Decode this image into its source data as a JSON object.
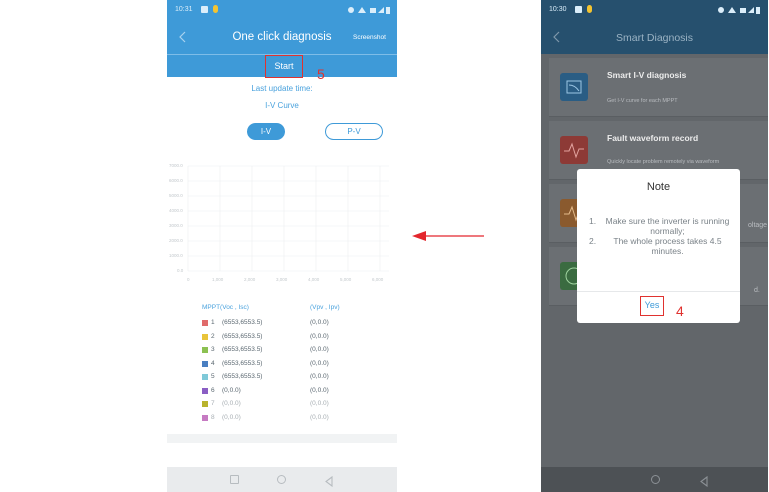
{
  "left": {
    "status_time": "10:31",
    "header_title": "One click diagnosis",
    "header_right": "Screenshot",
    "start_label": "Start",
    "step_number": "5",
    "last_update_label": "Last update time:",
    "curve_title": "I-V Curve",
    "tabs": [
      {
        "label": "I-V",
        "active": true
      },
      {
        "label": "P-V",
        "active": false
      }
    ],
    "chart": {
      "y_ticks": [
        "7000.0",
        "6000.0",
        "5000.0",
        "4000.0",
        "3000.0",
        "2000.0",
        "1000.0",
        "0.0"
      ],
      "x_ticks": [
        "0",
        "1,000",
        "2,000",
        "3,000",
        "4,000",
        "5,000",
        "6,000"
      ]
    },
    "mppt_header_left": "MPPT(Voc , Isc)",
    "mppt_header_right": "(Vpv , Ipv)",
    "mppt_rows": [
      {
        "index": "1",
        "voc_isc": "(6553,6553.5)",
        "vpv_ipv": "(0,0.0)",
        "color": "#e06b6b"
      },
      {
        "index": "2",
        "voc_isc": "(6553,6553.5)",
        "vpv_ipv": "(0,0.0)",
        "color": "#e9c43a"
      },
      {
        "index": "3",
        "voc_isc": "(6553,6553.5)",
        "vpv_ipv": "(0,0.0)",
        "color": "#8cc152"
      },
      {
        "index": "4",
        "voc_isc": "(6553,6553.5)",
        "vpv_ipv": "(0,0.0)",
        "color": "#4a7fc1"
      },
      {
        "index": "5",
        "voc_isc": "(6553,6553.5)",
        "vpv_ipv": "(0,0.0)",
        "color": "#7fc9d8"
      },
      {
        "index": "6",
        "voc_isc": "(0,0.0)",
        "vpv_ipv": "(0,0.0)",
        "color": "#8a5ec4"
      },
      {
        "index": "7",
        "voc_isc": "(0,0.0)",
        "vpv_ipv": "(0,0.0)",
        "color": "#b9b32e"
      },
      {
        "index": "8",
        "voc_isc": "(0,0.0)",
        "vpv_ipv": "(0,0.0)",
        "color": "#c67ac2"
      }
    ]
  },
  "right": {
    "status_time": "10:30",
    "header_title": "Smart Diagnosis",
    "cards": [
      {
        "title": "Smart I-V diagnosis",
        "subtitle": "Get I-V curve for each MPPT",
        "icon": "iv-chart-icon",
        "color": "#2a7bb5"
      },
      {
        "title": "Fault waveform record",
        "subtitle": "Quickly locate problem remotely via waveform",
        "icon": "waveform-icon",
        "color": "#c9453f"
      },
      {
        "title": "",
        "subtitle": "",
        "side_text": "oltage",
        "icon": "waveform-icon",
        "color": "#d17a2a"
      },
      {
        "title": "",
        "subtitle": "",
        "side_text": "d.",
        "icon": "circle-check-icon",
        "color": "#3f9a4a"
      }
    ],
    "dialog": {
      "title": "Note",
      "items": [
        {
          "num": "1.",
          "text": "Make sure the inverter is running normally;"
        },
        {
          "num": "2.",
          "text": "The whole process takes 4.5 minutes."
        }
      ],
      "yes_label": "Yes",
      "step_number": "4"
    }
  },
  "colors": {
    "accent": "#3e9ad8",
    "highlight": "#e0322f",
    "arrow": "#e3262d"
  }
}
